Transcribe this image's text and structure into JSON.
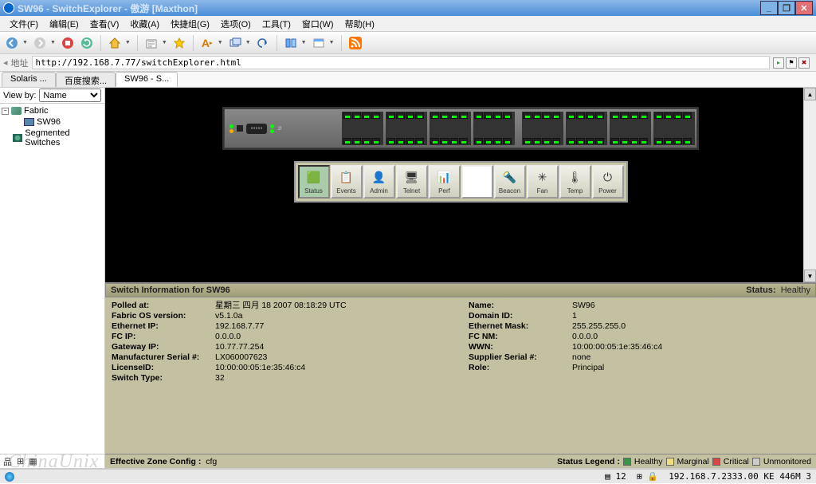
{
  "window_title": "SW96 - SwitchExplorer - 傲游 [Maxthon]",
  "menu": {
    "file": "文件(F)",
    "edit": "编辑(E)",
    "view": "查看(V)",
    "fav": "收藏(A)",
    "quick": "快捷组(G)",
    "option": "选项(O)",
    "tool": "工具(T)",
    "window": "窗口(W)",
    "help": "帮助(H)"
  },
  "addr": {
    "label": "地址",
    "url": "http://192.168.7.77/switchExplorer.html"
  },
  "tabs": [
    {
      "label": "Solaris ..."
    },
    {
      "label": "百度搜索..."
    },
    {
      "label": "SW96 - S..."
    }
  ],
  "sidebar": {
    "viewby_label": "View by:",
    "viewby_value": "Name",
    "tree": {
      "fabric": "Fabric",
      "sw": "SW96",
      "seg": "Segmented Switches"
    }
  },
  "ctrl_buttons": [
    "Status",
    "Events",
    "Admin",
    "Telnet",
    "Perf",
    "",
    "Beacon",
    "Fan",
    "Temp",
    "Power"
  ],
  "info": {
    "title": "Switch Information for SW96",
    "status_label": "Status:",
    "status_value": "Healthy",
    "left": [
      {
        "k": "Polled at:",
        "v": "星期三 四月 18 2007 08:18:29 UTC"
      },
      {
        "k": "Fabric OS version:",
        "v": "v5.1.0a"
      },
      {
        "k": "Ethernet IP:",
        "v": "192.168.7.77"
      },
      {
        "k": "FC IP:",
        "v": "0.0.0.0"
      },
      {
        "k": "Gateway IP:",
        "v": "10.77.77.254"
      },
      {
        "k": "Manufacturer Serial #:",
        "v": "LX060007623"
      },
      {
        "k": "LicenseID:",
        "v": "10:00:00:05:1e:35:46:c4"
      },
      {
        "k": "Switch Type:",
        "v": "32"
      }
    ],
    "right": [
      {
        "k": "Name:",
        "v": "SW96"
      },
      {
        "k": "Domain ID:",
        "v": "1"
      },
      {
        "k": "Ethernet Mask:",
        "v": "255.255.255.0"
      },
      {
        "k": "FC NM:",
        "v": "0.0.0.0"
      },
      {
        "k": "WWN:",
        "v": "10:00:00:05:1e:35:46:c4"
      },
      {
        "k": "Supplier Serial #:",
        "v": "none"
      },
      {
        "k": "Role:",
        "v": "Principal"
      }
    ]
  },
  "footer": {
    "zone_label": "Effective Zone Config :",
    "zone_value": "cfg",
    "legend_label": "Status Legend :",
    "l1": "Healthy",
    "l2": "Marginal",
    "l3": "Critical",
    "l4": "Unmonitored"
  },
  "status": {
    "count": "12",
    "text": "192.168.7.2333.00 KE 446M  3"
  },
  "watermark": "ChinaUnix"
}
